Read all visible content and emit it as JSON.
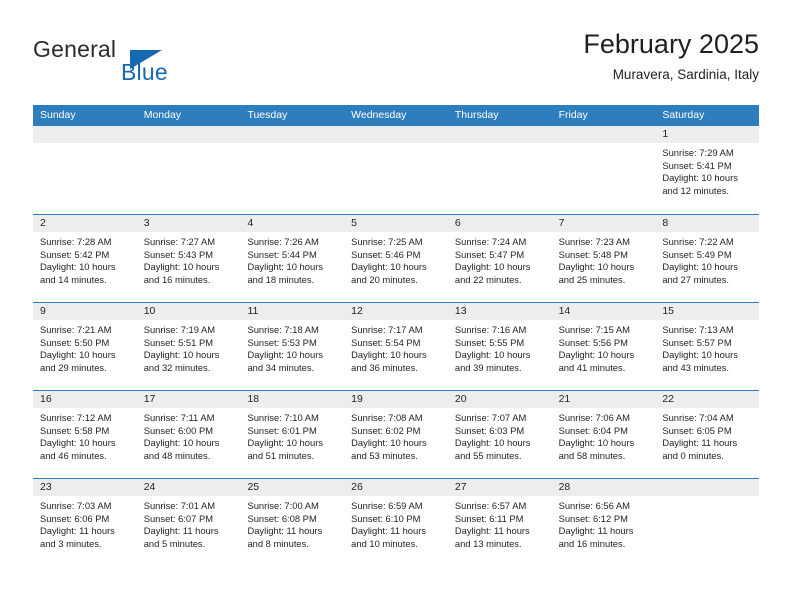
{
  "brand": {
    "name_top": "General",
    "name_bottom": "Blue",
    "triangle_color": "#1668b3"
  },
  "header": {
    "title": "February 2025",
    "subtitle": "Muravera, Sardinia, Italy"
  },
  "theme": {
    "header_blue": "#2e7ebd",
    "day_band_gray": "#ededed",
    "text": "#231f20"
  },
  "weekdays": [
    "Sunday",
    "Monday",
    "Tuesday",
    "Wednesday",
    "Thursday",
    "Friday",
    "Saturday"
  ],
  "labels": {
    "sunrise_prefix": "Sunrise: ",
    "sunset_prefix": "Sunset: ",
    "daylight_prefix": "Daylight: "
  },
  "weeks": [
    [
      {
        "empty": true
      },
      {
        "empty": true
      },
      {
        "empty": true
      },
      {
        "empty": true
      },
      {
        "empty": true
      },
      {
        "empty": true
      },
      {
        "day": "1",
        "sunrise": "Sunrise: 7:29 AM",
        "sunset": "Sunset: 5:41 PM",
        "daylight": "Daylight: 10 hours and 12 minutes."
      }
    ],
    [
      {
        "day": "2",
        "sunrise": "Sunrise: 7:28 AM",
        "sunset": "Sunset: 5:42 PM",
        "daylight": "Daylight: 10 hours and 14 minutes."
      },
      {
        "day": "3",
        "sunrise": "Sunrise: 7:27 AM",
        "sunset": "Sunset: 5:43 PM",
        "daylight": "Daylight: 10 hours and 16 minutes."
      },
      {
        "day": "4",
        "sunrise": "Sunrise: 7:26 AM",
        "sunset": "Sunset: 5:44 PM",
        "daylight": "Daylight: 10 hours and 18 minutes."
      },
      {
        "day": "5",
        "sunrise": "Sunrise: 7:25 AM",
        "sunset": "Sunset: 5:46 PM",
        "daylight": "Daylight: 10 hours and 20 minutes."
      },
      {
        "day": "6",
        "sunrise": "Sunrise: 7:24 AM",
        "sunset": "Sunset: 5:47 PM",
        "daylight": "Daylight: 10 hours and 22 minutes."
      },
      {
        "day": "7",
        "sunrise": "Sunrise: 7:23 AM",
        "sunset": "Sunset: 5:48 PM",
        "daylight": "Daylight: 10 hours and 25 minutes."
      },
      {
        "day": "8",
        "sunrise": "Sunrise: 7:22 AM",
        "sunset": "Sunset: 5:49 PM",
        "daylight": "Daylight: 10 hours and 27 minutes."
      }
    ],
    [
      {
        "day": "9",
        "sunrise": "Sunrise: 7:21 AM",
        "sunset": "Sunset: 5:50 PM",
        "daylight": "Daylight: 10 hours and 29 minutes."
      },
      {
        "day": "10",
        "sunrise": "Sunrise: 7:19 AM",
        "sunset": "Sunset: 5:51 PM",
        "daylight": "Daylight: 10 hours and 32 minutes."
      },
      {
        "day": "11",
        "sunrise": "Sunrise: 7:18 AM",
        "sunset": "Sunset: 5:53 PM",
        "daylight": "Daylight: 10 hours and 34 minutes."
      },
      {
        "day": "12",
        "sunrise": "Sunrise: 7:17 AM",
        "sunset": "Sunset: 5:54 PM",
        "daylight": "Daylight: 10 hours and 36 minutes."
      },
      {
        "day": "13",
        "sunrise": "Sunrise: 7:16 AM",
        "sunset": "Sunset: 5:55 PM",
        "daylight": "Daylight: 10 hours and 39 minutes."
      },
      {
        "day": "14",
        "sunrise": "Sunrise: 7:15 AM",
        "sunset": "Sunset: 5:56 PM",
        "daylight": "Daylight: 10 hours and 41 minutes."
      },
      {
        "day": "15",
        "sunrise": "Sunrise: 7:13 AM",
        "sunset": "Sunset: 5:57 PM",
        "daylight": "Daylight: 10 hours and 43 minutes."
      }
    ],
    [
      {
        "day": "16",
        "sunrise": "Sunrise: 7:12 AM",
        "sunset": "Sunset: 5:58 PM",
        "daylight": "Daylight: 10 hours and 46 minutes."
      },
      {
        "day": "17",
        "sunrise": "Sunrise: 7:11 AM",
        "sunset": "Sunset: 6:00 PM",
        "daylight": "Daylight: 10 hours and 48 minutes."
      },
      {
        "day": "18",
        "sunrise": "Sunrise: 7:10 AM",
        "sunset": "Sunset: 6:01 PM",
        "daylight": "Daylight: 10 hours and 51 minutes."
      },
      {
        "day": "19",
        "sunrise": "Sunrise: 7:08 AM",
        "sunset": "Sunset: 6:02 PM",
        "daylight": "Daylight: 10 hours and 53 minutes."
      },
      {
        "day": "20",
        "sunrise": "Sunrise: 7:07 AM",
        "sunset": "Sunset: 6:03 PM",
        "daylight": "Daylight: 10 hours and 55 minutes."
      },
      {
        "day": "21",
        "sunrise": "Sunrise: 7:06 AM",
        "sunset": "Sunset: 6:04 PM",
        "daylight": "Daylight: 10 hours and 58 minutes."
      },
      {
        "day": "22",
        "sunrise": "Sunrise: 7:04 AM",
        "sunset": "Sunset: 6:05 PM",
        "daylight": "Daylight: 11 hours and 0 minutes."
      }
    ],
    [
      {
        "day": "23",
        "sunrise": "Sunrise: 7:03 AM",
        "sunset": "Sunset: 6:06 PM",
        "daylight": "Daylight: 11 hours and 3 minutes."
      },
      {
        "day": "24",
        "sunrise": "Sunrise: 7:01 AM",
        "sunset": "Sunset: 6:07 PM",
        "daylight": "Daylight: 11 hours and 5 minutes."
      },
      {
        "day": "25",
        "sunrise": "Sunrise: 7:00 AM",
        "sunset": "Sunset: 6:08 PM",
        "daylight": "Daylight: 11 hours and 8 minutes."
      },
      {
        "day": "26",
        "sunrise": "Sunrise: 6:59 AM",
        "sunset": "Sunset: 6:10 PM",
        "daylight": "Daylight: 11 hours and 10 minutes."
      },
      {
        "day": "27",
        "sunrise": "Sunrise: 6:57 AM",
        "sunset": "Sunset: 6:11 PM",
        "daylight": "Daylight: 11 hours and 13 minutes."
      },
      {
        "day": "28",
        "sunrise": "Sunrise: 6:56 AM",
        "sunset": "Sunset: 6:12 PM",
        "daylight": "Daylight: 11 hours and 16 minutes."
      },
      {
        "empty": true
      }
    ]
  ]
}
